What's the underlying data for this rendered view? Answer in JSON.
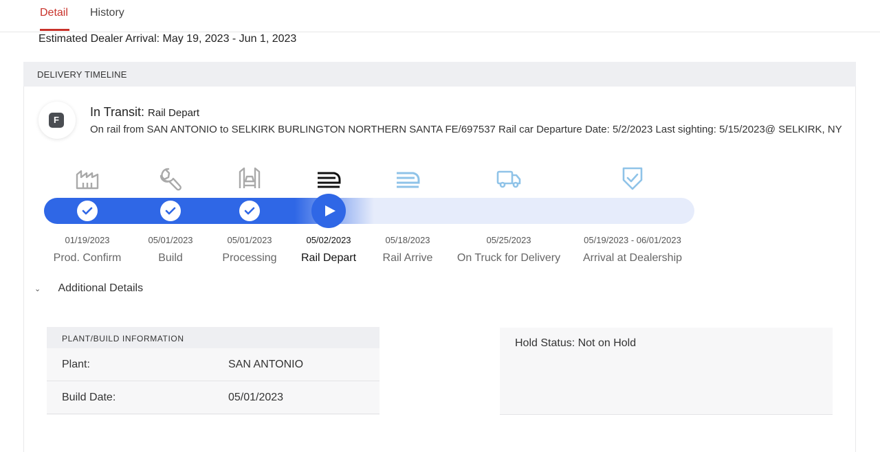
{
  "tabs": [
    {
      "label": "Detail",
      "active": true
    },
    {
      "label": "History",
      "active": false
    }
  ],
  "estimated_arrival": "Estimated Dealer Arrival: May 19, 2023 - Jun 1, 2023",
  "timeline": {
    "header": "DELIVERY TIMELINE",
    "badge_letter": "F",
    "status_prefix": "In Transit:",
    "status_value": "Rail Depart",
    "description": "On rail from SAN ANTONIO to SELKIRK BURLINGTON NORTHERN SANTA FE/697537 Rail car Departure Date: 5/2/2023 Last sighting: 5/15/2023@ SELKIRK, NY",
    "stages": [
      {
        "label": "Prod. Confirm",
        "date": "01/19/2023",
        "state": "done",
        "icon": "factory-icon"
      },
      {
        "label": "Build",
        "date": "05/01/2023",
        "state": "done",
        "icon": "wrench-icon"
      },
      {
        "label": "Processing",
        "date": "05/01/2023",
        "state": "done",
        "icon": "car-lift-icon"
      },
      {
        "label": "Rail Depart",
        "date": "05/02/2023",
        "state": "current",
        "icon": "train-icon"
      },
      {
        "label": "Rail Arrive",
        "date": "05/18/2023",
        "state": "upcoming",
        "icon": "train-icon"
      },
      {
        "label": "On Truck for Delivery",
        "date": "05/25/2023",
        "state": "upcoming",
        "icon": "truck-icon"
      },
      {
        "label": "Arrival at Dealership",
        "date": "05/19/2023 - 06/01/2023",
        "state": "upcoming",
        "icon": "shield-check-icon"
      }
    ],
    "colors": {
      "progress": "#2f67e6",
      "track": "#e6ecfb",
      "done_icon": "#a9a9a9",
      "current_icon": "#111111",
      "upcoming_icon": "#8fc3e8",
      "accent": "#c8322a"
    }
  },
  "additional_details": {
    "label": "Additional Details",
    "plant_info": {
      "header": "PLANT/BUILD INFORMATION",
      "rows": [
        {
          "key": "Plant:",
          "value": "SAN ANTONIO"
        },
        {
          "key": "Build Date:",
          "value": "05/01/2023"
        }
      ]
    },
    "hold_status": "Hold Status: Not on Hold"
  }
}
